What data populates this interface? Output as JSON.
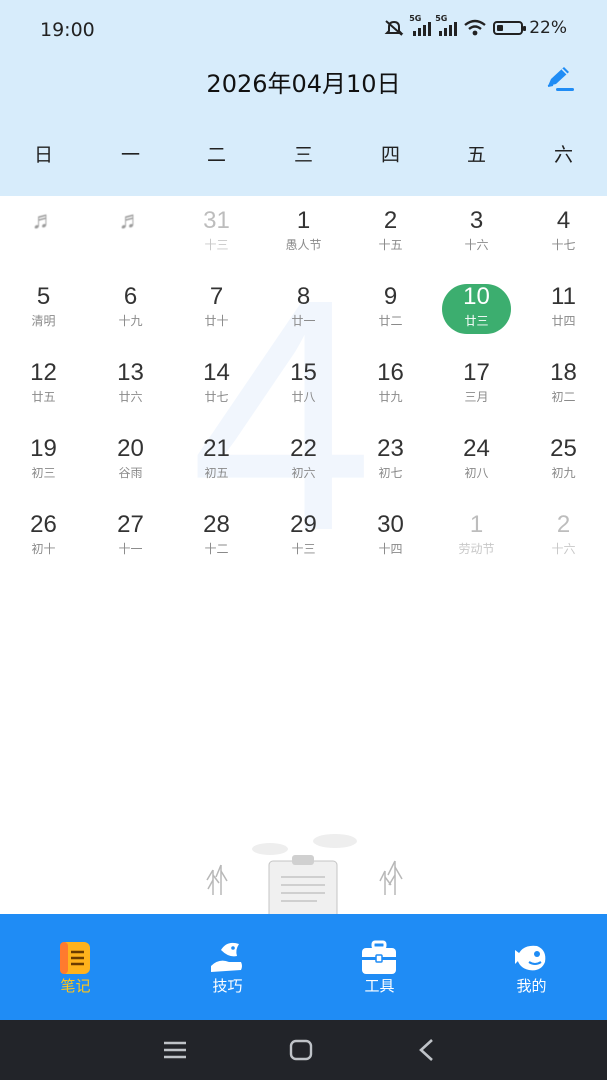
{
  "status_bar": {
    "time": "19:00",
    "signal1_label": "5G",
    "signal2_label": "5G",
    "battery": "22%"
  },
  "header": {
    "title": "2026年04月10日"
  },
  "weekdays": [
    "日",
    "一",
    "二",
    "三",
    "四",
    "五",
    "六"
  ],
  "calendar": {
    "watermark": "4",
    "rows": [
      [
        {
          "day": "",
          "lunar": ""
        },
        {
          "day": "",
          "lunar": ""
        },
        {
          "day": "31",
          "lunar": "十三"
        },
        {
          "day": "1",
          "lunar": "愚人节"
        },
        {
          "day": "2",
          "lunar": "十五"
        },
        {
          "day": "3",
          "lunar": "十六"
        },
        {
          "day": "4",
          "lunar": "十七"
        }
      ],
      [
        {
          "day": "5",
          "lunar": "清明"
        },
        {
          "day": "6",
          "lunar": "十九"
        },
        {
          "day": "7",
          "lunar": "廿十"
        },
        {
          "day": "8",
          "lunar": "廿一"
        },
        {
          "day": "9",
          "lunar": "廿二"
        },
        {
          "day": "10",
          "lunar": "廿三"
        },
        {
          "day": "11",
          "lunar": "廿四"
        }
      ],
      [
        {
          "day": "12",
          "lunar": "廿五"
        },
        {
          "day": "13",
          "lunar": "廿六"
        },
        {
          "day": "14",
          "lunar": "廿七"
        },
        {
          "day": "15",
          "lunar": "廿八"
        },
        {
          "day": "16",
          "lunar": "廿九"
        },
        {
          "day": "17",
          "lunar": "三月"
        },
        {
          "day": "18",
          "lunar": "初二"
        }
      ],
      [
        {
          "day": "19",
          "lunar": "初三"
        },
        {
          "day": "20",
          "lunar": "谷雨"
        },
        {
          "day": "21",
          "lunar": "初五"
        },
        {
          "day": "22",
          "lunar": "初六"
        },
        {
          "day": "23",
          "lunar": "初七"
        },
        {
          "day": "24",
          "lunar": "初八"
        },
        {
          "day": "25",
          "lunar": "初九"
        }
      ],
      [
        {
          "day": "26",
          "lunar": "初十"
        },
        {
          "day": "27",
          "lunar": "十一"
        },
        {
          "day": "28",
          "lunar": "十二"
        },
        {
          "day": "29",
          "lunar": "十三"
        },
        {
          "day": "30",
          "lunar": "十四"
        },
        {
          "day": "1",
          "lunar": "劳动节"
        },
        {
          "day": "2",
          "lunar": "十六"
        }
      ]
    ],
    "selected_day": "10"
  },
  "tabs": [
    {
      "label": "笔记",
      "icon": "notebook-icon",
      "active": true
    },
    {
      "label": "技巧",
      "icon": "fish-hand-icon",
      "active": false
    },
    {
      "label": "工具",
      "icon": "toolbox-icon",
      "active": false
    },
    {
      "label": "我的",
      "icon": "fish-profile-icon",
      "active": false
    }
  ],
  "colors": {
    "header_bg": "#d7ecfb",
    "tab_bar": "#1f8cf5",
    "today": "#3cae6f",
    "active_tab_label": "#ffc51a"
  }
}
